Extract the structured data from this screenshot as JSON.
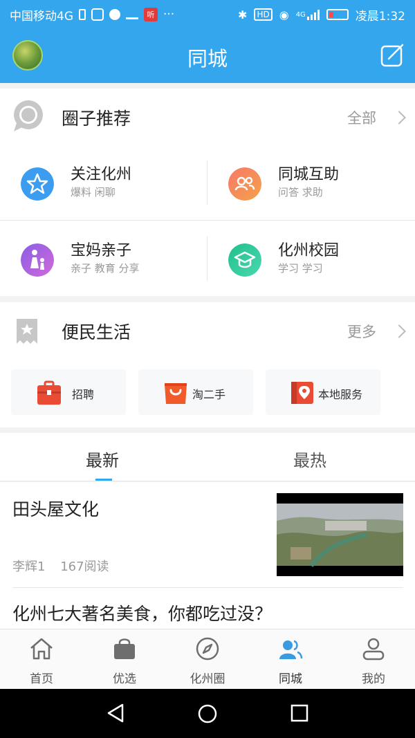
{
  "status_bar": {
    "carrier": "中国移动4G",
    "red_badge": "听",
    "dots": "···",
    "hd": "HD",
    "net": "4G",
    "time": "凌晨1:32"
  },
  "header": {
    "title": "同城"
  },
  "circles": {
    "title": "圈子推荐",
    "more": "全部",
    "items": [
      {
        "name": "关注化州",
        "tags": "爆料  闲聊",
        "icon": "star-icon",
        "color": "#3b9cf0"
      },
      {
        "name": "同城互助",
        "tags": "问答  求助",
        "icon": "people-icon",
        "color": "#f0695a"
      },
      {
        "name": "宝妈亲子",
        "tags": "亲子  教育  分享",
        "icon": "mother-child-icon",
        "color": "#a05ae0"
      },
      {
        "name": "化州校园",
        "tags": "学习  学习",
        "icon": "graduation-cap-icon",
        "color": "#2ec79b"
      }
    ]
  },
  "services": {
    "title": "便民生活",
    "more": "更多",
    "items": [
      {
        "label": "招聘",
        "icon": "briefcase-icon",
        "color": "#e94b35"
      },
      {
        "label": "淘二手",
        "icon": "shopping-bag-icon",
        "color": "#f15a2b"
      },
      {
        "label": "本地服务",
        "icon": "location-pin-icon",
        "color": "#e94b35"
      }
    ]
  },
  "feed_tabs": {
    "latest": "最新",
    "hot": "最热"
  },
  "articles": [
    {
      "title": "田头屋文化",
      "author": "李辉1",
      "reads": "167阅读"
    },
    {
      "title": "化州七大著名美食，你都吃过没？"
    }
  ],
  "tabbar": [
    {
      "label": "首页",
      "icon": "home-icon"
    },
    {
      "label": "优选",
      "icon": "shopping-bag-icon"
    },
    {
      "label": "化州圈",
      "icon": "compass-icon"
    },
    {
      "label": "同城",
      "icon": "people-icon",
      "active": true
    },
    {
      "label": "我的",
      "icon": "person-icon"
    }
  ],
  "colors": {
    "brand": "#33a6ee",
    "active_tab": "#33a6ee"
  }
}
